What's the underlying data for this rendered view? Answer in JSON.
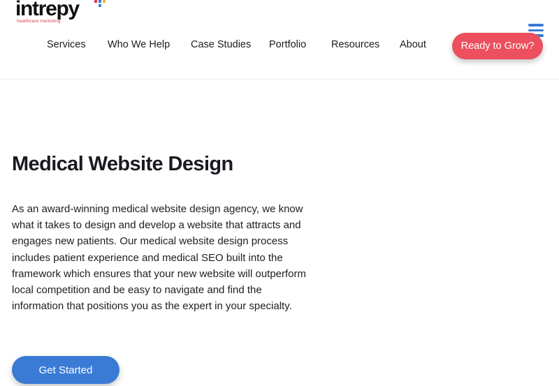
{
  "logo": {
    "wordmark": "intrepy",
    "tagline": "healthcare marketing",
    "mark_colors": [
      "#e23b4e",
      "#3d79d3",
      "#f2b632",
      "#3d79d3"
    ]
  },
  "nav": {
    "items": [
      {
        "label": "Services"
      },
      {
        "label": "Who We Help"
      },
      {
        "label": "Case Studies"
      },
      {
        "label": "Portfolio"
      },
      {
        "label": "Resources"
      },
      {
        "label": "About"
      }
    ],
    "cta_label": "Ready to Grow?",
    "menu_icon": "hamburger-menu-icon"
  },
  "hero": {
    "title": "Medical Website Design",
    "body": "As an award-winning medical website design agency, we know what it takes to design and develop a website that attracts and engages new patients. Our medical website design process includes patient experience and medical SEO built into the framework which ensures that your new website will outperform local competition and be easy to navigate and find the information that positions you as the expert in your specialty.",
    "cta_label": "Get Started"
  },
  "colors": {
    "accent_red": "#ec4f5d",
    "accent_blue": "#3a7bd5",
    "text": "#1a1a1a"
  }
}
